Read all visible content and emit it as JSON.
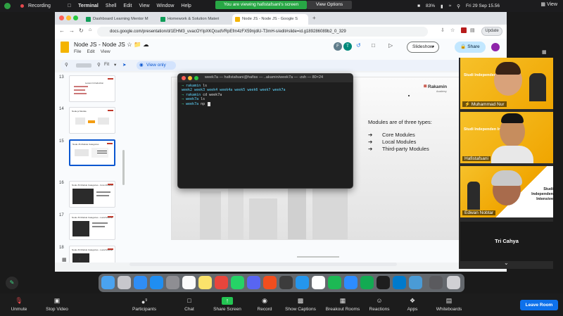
{
  "menubar": {
    "recording_label": "Recording",
    "app_name": "Terminal",
    "menus": [
      "Shell",
      "Edit",
      "View",
      "Window",
      "Help"
    ],
    "viewing_banner": "You are viewing hafistafsani's screen",
    "view_options": "View Options",
    "battery": "83%",
    "datetime": "Fri 29 Sep  15.56",
    "view_label": "View"
  },
  "browser": {
    "tabs": [
      {
        "label": "Dashboard Learning Mentor M"
      },
      {
        "label": "Homework & Solution Materi"
      },
      {
        "label": "Node JS - Node JS - Google S"
      }
    ],
    "url": "docs.google.com/presentation/d/1EHM3_uvacOYIpXKQcudVRpEfm4zFX59njdiU-T3mH-s/edit#slide=id.g189286089b2_0_329",
    "update_label": "Update"
  },
  "slides_app": {
    "doc_title": "Node JS - Node JS",
    "menus": [
      "File",
      "Edit",
      "View"
    ],
    "zoom": "Fit",
    "view_only": "View only",
    "slideshow_label": "Slideshow",
    "share_label": "Share",
    "avatars": [
      "F",
      "T"
    ]
  },
  "filmstrip": {
    "thumbs": [
      {
        "num": "13",
        "title": "Lesson Introduction"
      },
      {
        "num": "14",
        "title": "Node.js Module"
      },
      {
        "num": "15",
        "title": "Node.JS Module Categories"
      },
      {
        "num": "16",
        "title": "Node.JS Module Categories - Core Modules"
      },
      {
        "num": "17",
        "title": "Node.JS Module Categories - Local Module"
      },
      {
        "num": "18",
        "title": "Node.JS Module Categories - Local Module"
      }
    ]
  },
  "slide": {
    "logo": "Rakamin",
    "logo_sub": "Academy",
    "heading": "Modules are of three types:",
    "items": [
      "Core Modules",
      "Local Modules",
      "Third-party Modules"
    ],
    "arrow": "➔"
  },
  "terminal": {
    "title": "week7a — hafistafsani@hafiss — ..akamin/week7a — -zsh — 80×24",
    "lines": [
      {
        "arrow": "→",
        "dir": "rakamin",
        "cmd": "ls"
      },
      {
        "plain": "week2  week3  week4  week4a  week5  week6  week7  week7a"
      },
      {
        "arrow": "→",
        "dir": "rakamin",
        "cmd": "cd week7a"
      },
      {
        "arrow": "→",
        "dir": "week7a",
        "cmd": "ls"
      },
      {
        "arrow": "→",
        "dir": "week7a",
        "cmd": "np"
      }
    ]
  },
  "gallery": {
    "participants": [
      {
        "name": "Muhammad Nur",
        "badge": "Studi Independen Intensive"
      },
      {
        "name": "Hafistafsani",
        "badge": "Studi Independen Intensive"
      },
      {
        "name": "Edwan Nobtar",
        "badge": "Studi Independen Intensive"
      }
    ],
    "speaker": "Tri Cahya"
  },
  "zoom_controls": {
    "unmute": "Unmute",
    "stop_video": "Stop Video",
    "participants": "Participants",
    "participants_count": "9",
    "chat": "Chat",
    "share_screen": "Share Screen",
    "record": "Record",
    "show_captions": "Show Captions",
    "breakout_rooms": "Breakout Rooms",
    "reactions": "Reactions",
    "apps": "Apps",
    "whiteboards": "Whiteboards",
    "leave": "Leave Room"
  },
  "colors": {
    "share_green": "#23c552",
    "leave_blue": "#0e71eb",
    "banner_green": "#28a745",
    "tile_yellow": "#f5b400"
  }
}
